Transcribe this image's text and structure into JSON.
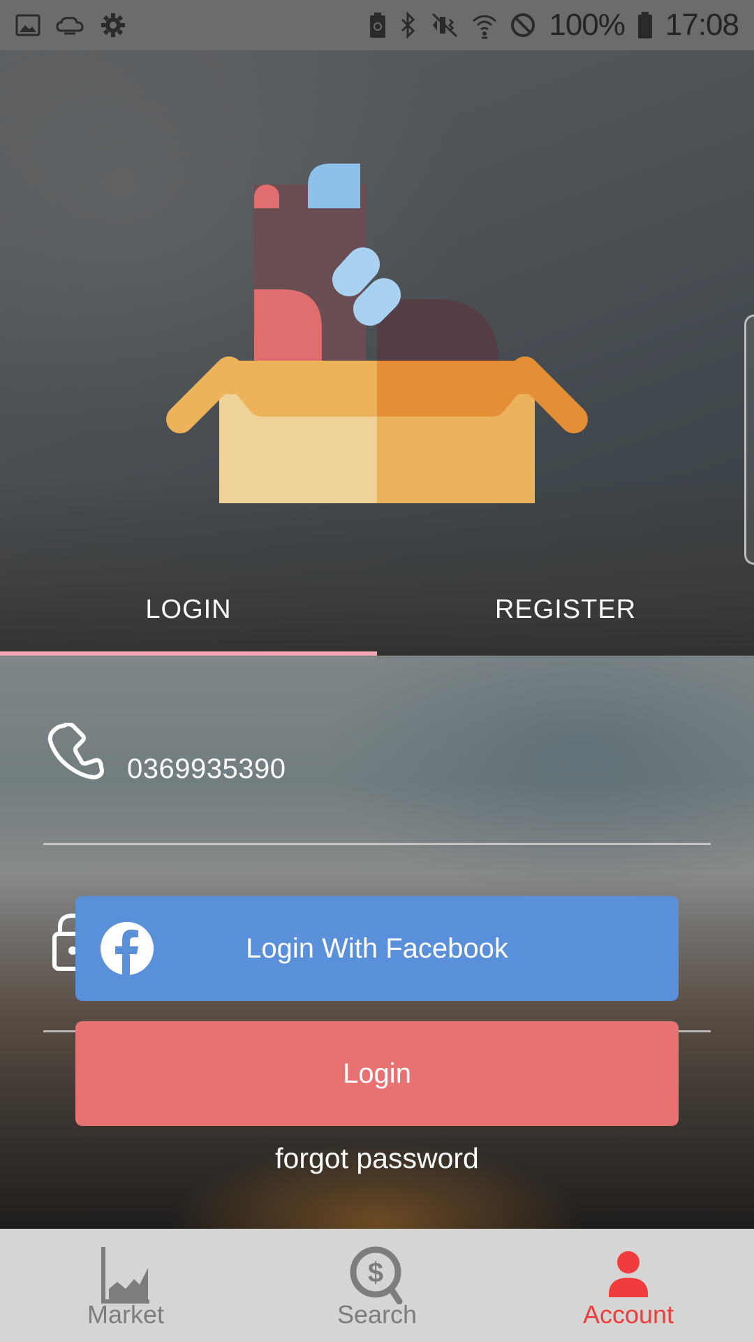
{
  "status_bar": {
    "battery": "100%",
    "time": "17:08",
    "left_icons": [
      "image-icon",
      "weather-icon",
      "settings-icon"
    ],
    "right_icons": [
      "battery-saver-icon",
      "bluetooth-icon",
      "vibrate-icon",
      "wifi-icon",
      "do-not-disturb-icon",
      "battery-icon"
    ]
  },
  "tabs": [
    {
      "label": "LOGIN",
      "active": true
    },
    {
      "label": "REGISTER",
      "active": false
    }
  ],
  "form": {
    "phone_value": "0369935390",
    "facebook_button": "Login With Facebook",
    "login_button": "Login",
    "forgot_password": "forgot password"
  },
  "bottom_nav": [
    {
      "label": "Market",
      "icon": "area-chart-icon",
      "active": false
    },
    {
      "label": "Search",
      "icon": "dollar-search-icon",
      "active": false
    },
    {
      "label": "Account",
      "icon": "person-icon",
      "active": true
    }
  ],
  "colors": {
    "facebook_button": "#5a8fd9",
    "login_button": "#e87171",
    "tab_indicator": "#f2a7b4",
    "nav_active": "#f03c3c",
    "nav_inactive": "#7d7d7d"
  }
}
